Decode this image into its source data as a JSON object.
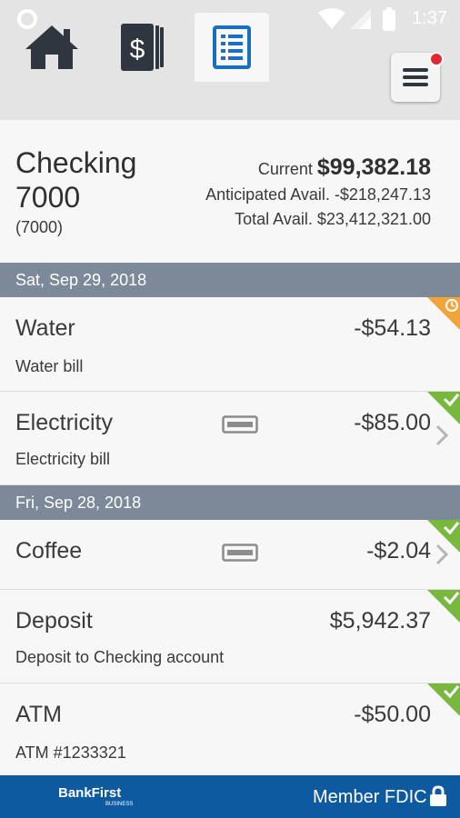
{
  "status_bar": {
    "time": "1:37"
  },
  "tabs": [
    {
      "name": "home",
      "icon": "home-icon"
    },
    {
      "name": "money",
      "icon": "dollar-icon"
    },
    {
      "name": "statement",
      "icon": "statement-icon",
      "active": true
    }
  ],
  "menu": {
    "icon": "hamburger-menu-icon",
    "notification": true
  },
  "account": {
    "name": "Checking 7000",
    "number": "(7000)",
    "current_label": "Current",
    "current_value": "$99,382.18",
    "anticipated": "Anticipated Avail. -$218,247.13",
    "total": "Total Avail. $23,412,321.00"
  },
  "groups": [
    {
      "date": "Sat, Sep 29, 2018"
    },
    {
      "date": "Fri, Sep 28, 2018"
    }
  ],
  "transactions": [
    {
      "title": "Water",
      "amount": "-$54.13",
      "description": "Water bill",
      "status": "pending"
    },
    {
      "title": "Electricity",
      "amount": "-$85.00",
      "description": "Electricity bill",
      "status": "cleared",
      "card": true,
      "chevron": true
    },
    {
      "title": "Coffee",
      "amount": "-$2.04",
      "description": "",
      "status": "cleared",
      "card": true,
      "chevron": true
    },
    {
      "title": "Deposit",
      "amount": "$5,942.37",
      "description": "Deposit to Checking account",
      "status": "cleared"
    },
    {
      "title": "ATM",
      "amount": "-$50.00",
      "description": "ATM #1233321",
      "status": "cleared"
    }
  ],
  "footer": {
    "logo": "BankFirst",
    "logo_sub": "BUSINESS",
    "member": "Member FDIC"
  },
  "colors": {
    "header_bar": "#7b8998",
    "footer": "#0e5aa1",
    "cleared": "#79b83e",
    "pending": "#f2a33a",
    "accent_blue": "#1a6fc1",
    "notification": "#e32733"
  }
}
